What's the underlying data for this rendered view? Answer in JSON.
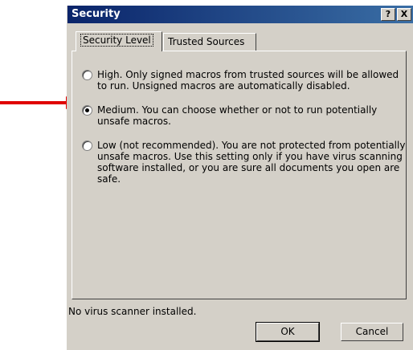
{
  "window": {
    "title": "Security",
    "help_label": "?",
    "close_label": "X"
  },
  "tabs": [
    {
      "label": "Security Level",
      "active": true
    },
    {
      "label": "Trusted Sources",
      "active": false
    }
  ],
  "options": [
    {
      "label": "High. Only signed macros from trusted sources will be allowed to run. Unsigned macros are automatically disabled.",
      "selected": false
    },
    {
      "label": "Medium. You can choose whether or not to run potentially unsafe macros.",
      "selected": true
    },
    {
      "label": "Low (not recommended). You are not protected from potentially unsafe macros. Use this setting only if you have virus scanning software installed, or you are sure all documents you open are safe.",
      "selected": false
    }
  ],
  "status_text": "No virus scanner installed.",
  "buttons": {
    "ok": "OK",
    "cancel": "Cancel"
  },
  "colors": {
    "arrow": "#e00000",
    "titlebar": "#0a246a",
    "dialog_face": "#d4d0c8"
  }
}
